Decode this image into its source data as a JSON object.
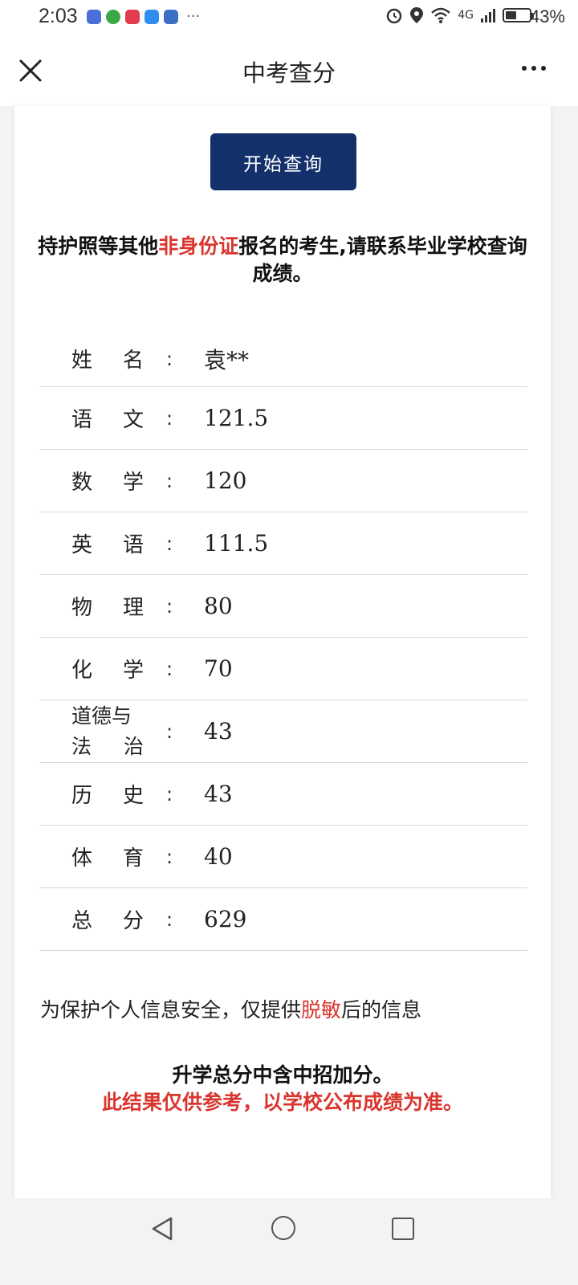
{
  "status_bar": {
    "time": "2:03",
    "more": "···",
    "network": "4G",
    "battery_percent": "43%",
    "battery_level": 0.43,
    "icons": [
      "alarm-icon",
      "location-icon",
      "wifi-icon",
      "signal-icon",
      "battery-icon"
    ]
  },
  "titlebar": {
    "title": "中考查分",
    "close_icon": "close-icon",
    "more_icon": "more-icon"
  },
  "query_button": {
    "label": "开始查询",
    "color": "#14306b"
  },
  "notice": {
    "part1": "持护照等其他",
    "highlight": "非身份证",
    "part2": "报名的考生,请联系毕业学校查询成绩。"
  },
  "scores": [
    {
      "label": "姓　名",
      "chars": [
        "姓",
        "名"
      ],
      "value": "袁**"
    },
    {
      "label": "语　文",
      "chars": [
        "语",
        "文"
      ],
      "value": "121.5"
    },
    {
      "label": "数　学",
      "chars": [
        "数",
        "学"
      ],
      "value": "120"
    },
    {
      "label": "英　语",
      "chars": [
        "英",
        "语"
      ],
      "value": "111.5"
    },
    {
      "label": "物　理",
      "chars": [
        "物",
        "理"
      ],
      "value": "80"
    },
    {
      "label": "化　学",
      "chars": [
        "化",
        "学"
      ],
      "value": "70"
    },
    {
      "label": "道德与法　治",
      "line1": "道德与",
      "line2_chars": [
        "法",
        "治"
      ],
      "value": "43"
    },
    {
      "label": "历　史",
      "chars": [
        "历",
        "史"
      ],
      "value": "43"
    },
    {
      "label": "体　育",
      "chars": [
        "体",
        "育"
      ],
      "value": "40"
    },
    {
      "label": "总　分",
      "chars": [
        "总",
        "分"
      ],
      "value": "629"
    }
  ],
  "colon": ":",
  "privacy": {
    "part1": "为保护个人信息安全，仅提供",
    "highlight": "脱敏",
    "part2": "后的信息"
  },
  "footnote": {
    "line1": "升学总分中含中招加分。",
    "line2": "此结果仅供参考，以学校公布成绩为准。"
  },
  "colors": {
    "accent_red": "#d9352e",
    "button_navy": "#14306b"
  }
}
